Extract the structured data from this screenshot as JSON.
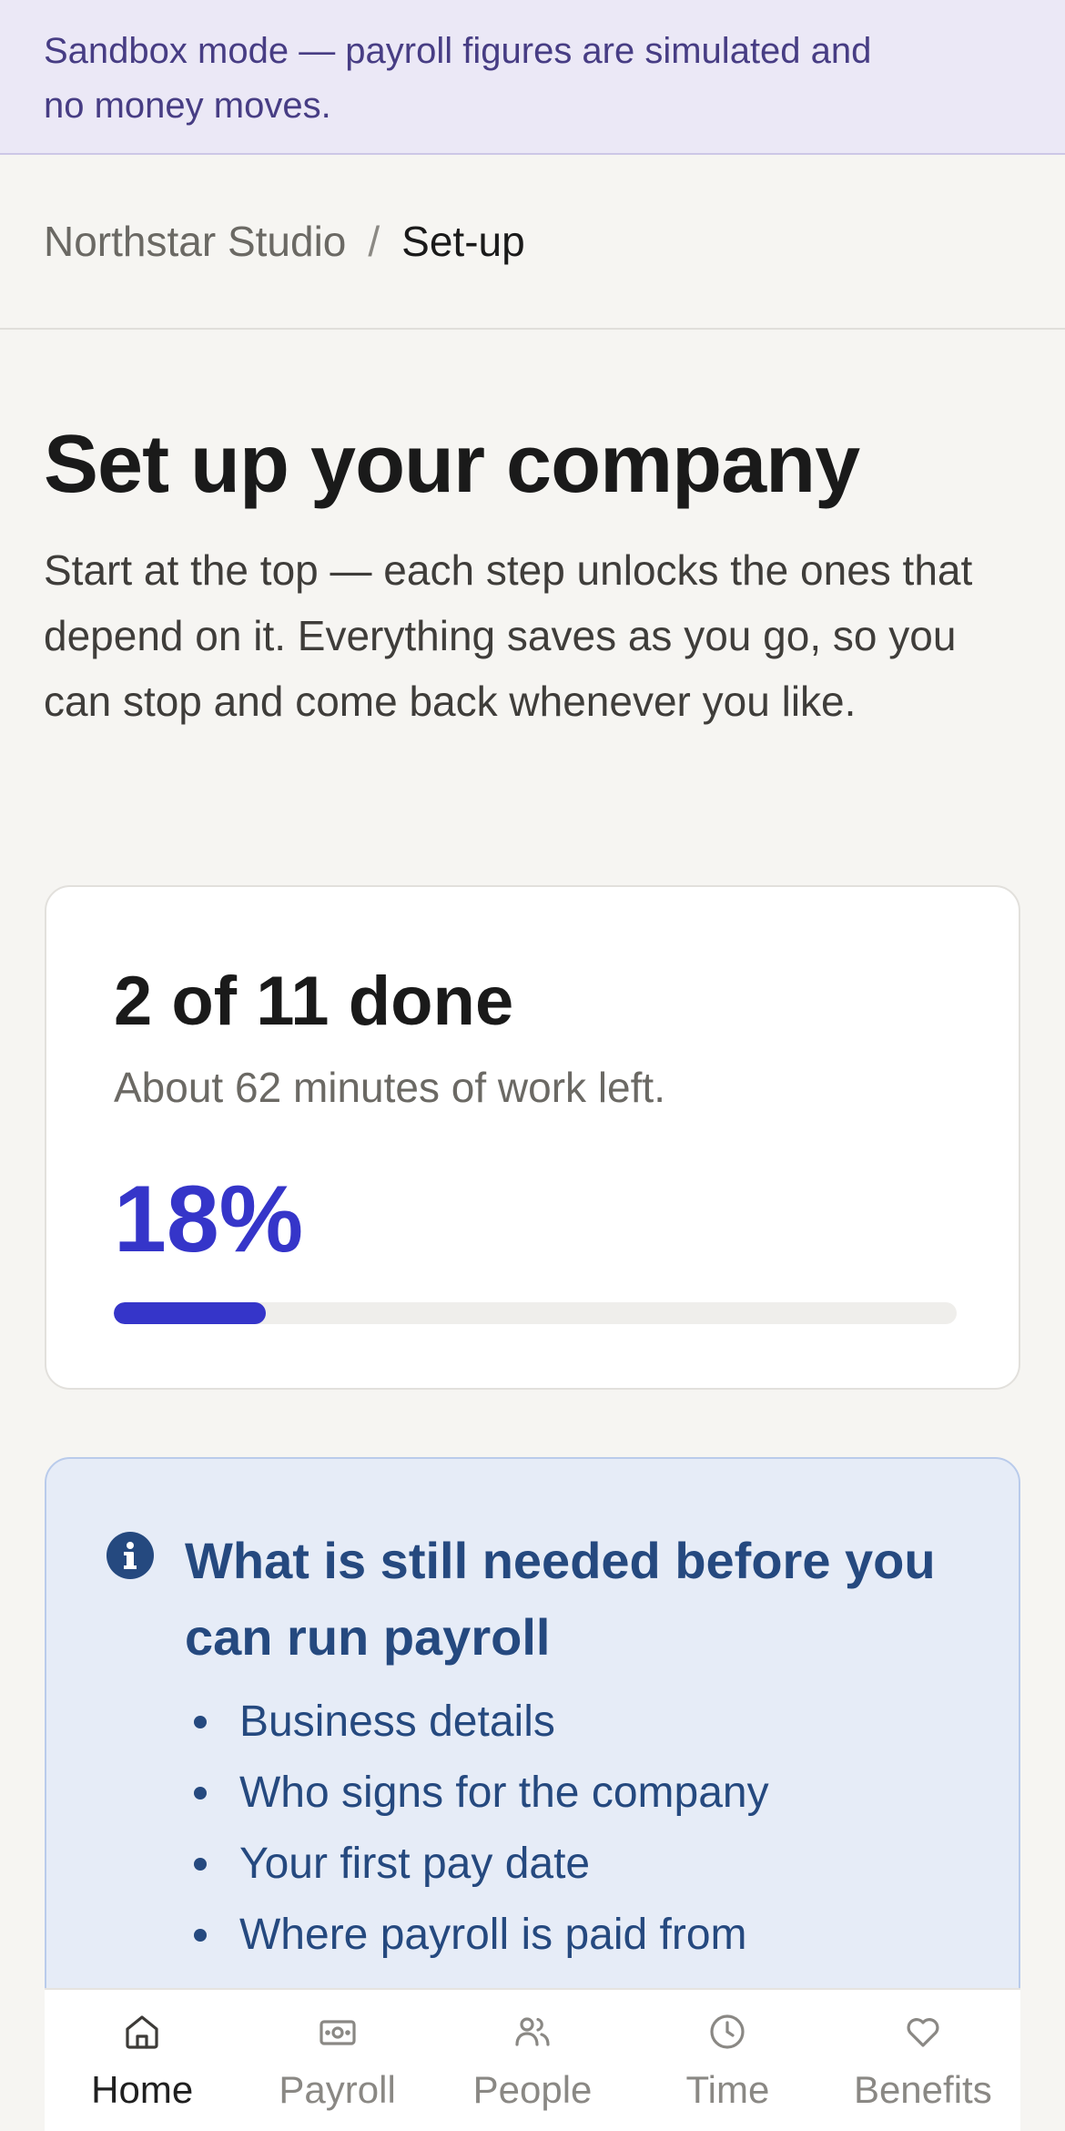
{
  "banner": {
    "line1": "Sandbox mode — payroll figures are simulated and",
    "line2": "no money moves."
  },
  "breadcrumb": {
    "parent": "Northstar Studio",
    "separator": "/",
    "current": "Set-up"
  },
  "page": {
    "title": "Set up your company",
    "intro": "Start at the top — each step unlocks the ones that depend on it. Everything saves as you go, so you can stop and come back whenever you like."
  },
  "progress": {
    "count_text": "2 of 11 done",
    "remaining_text": "About 62 minutes of work left.",
    "percent_text": "18%",
    "percent_value": 18,
    "accent_color": "#3535c9"
  },
  "callout": {
    "icon": "info-icon",
    "heading": "What is still needed before you can run payroll",
    "items": [
      "Business details",
      "Who signs for the company",
      "Your first pay date",
      "Where payroll is paid from"
    ]
  },
  "nav": {
    "items": [
      {
        "label": "Home",
        "icon": "home-icon",
        "active": true
      },
      {
        "label": "Payroll",
        "icon": "banknote-icon",
        "active": false
      },
      {
        "label": "People",
        "icon": "people-icon",
        "active": false
      },
      {
        "label": "Time",
        "icon": "clock-icon",
        "active": false
      },
      {
        "label": "Benefits",
        "icon": "heart-icon",
        "active": false
      }
    ]
  }
}
